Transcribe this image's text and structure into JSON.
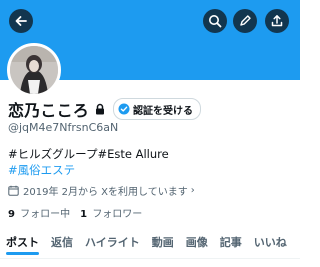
{
  "colors": {
    "banner": "#1d9bf0",
    "accent": "#1d9bf0",
    "text": "#0f1419",
    "muted": "#536471"
  },
  "header": {
    "back_icon": "arrow-left-icon",
    "search_icon": "search-icon",
    "edit_icon": "pencil-icon",
    "share_icon": "share-icon"
  },
  "profile": {
    "display_name": "恋乃こころ",
    "lock_icon": "lock-icon",
    "verify_label": "認証を受ける",
    "handle": "@jqM4e7NfrsnC6aN",
    "bio_line1": "#ヒルズグループ#Este Allure",
    "bio_line2": "#風俗エステ",
    "joined": "2019年 2月から Xを利用しています",
    "joined_chevron": "›",
    "following_count": "9",
    "following_label": "フォロー中",
    "followers_count": "1",
    "followers_label": "フォロワー"
  },
  "tabs": [
    {
      "label": "ポスト",
      "active": true
    },
    {
      "label": "返信"
    },
    {
      "label": "ハイライト"
    },
    {
      "label": "動画"
    },
    {
      "label": "画像"
    },
    {
      "label": "記事"
    },
    {
      "label": "いいね"
    }
  ]
}
